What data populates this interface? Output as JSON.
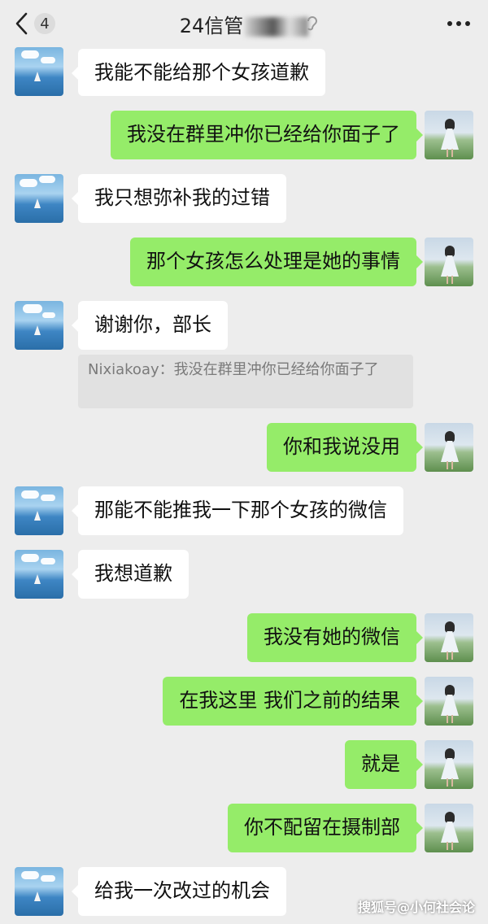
{
  "header": {
    "unread_count": "4",
    "title": "24信管",
    "back_icon": "chevron-left-icon",
    "voice_icon": "ear-icon",
    "more_icon": "more-dots-icon"
  },
  "messages": [
    {
      "side": "left",
      "text": "我能不能给那个女孩道歉"
    },
    {
      "side": "right",
      "text": "我没在群里冲你已经给你面子了"
    },
    {
      "side": "left",
      "text": "我只想弥补我的过错"
    },
    {
      "side": "right",
      "text": "那个女孩怎么处理是她的事情"
    },
    {
      "side": "left",
      "text": "谢谢你，部长"
    },
    {
      "side": "right",
      "text": "你和我说没用"
    },
    {
      "side": "left",
      "text": "那能不能推我一下那个女孩的微信"
    },
    {
      "side": "left",
      "text": "我想道歉"
    },
    {
      "side": "right",
      "text": "我没有她的微信"
    },
    {
      "side": "right",
      "text": "在我这里 我们之前的结果"
    },
    {
      "side": "right",
      "text": "就是"
    },
    {
      "side": "right",
      "text": "你不配留在摄制部"
    },
    {
      "side": "left",
      "text": "给我一次改过的机会"
    }
  ],
  "quote": {
    "text": "Nixiakoay：我没在群里冲你已经给你面子了"
  },
  "watermark": "搜狐号@小何社会论",
  "colors": {
    "background": "#ededed",
    "sent_bubble": "#95ec69",
    "received_bubble": "#ffffff"
  }
}
